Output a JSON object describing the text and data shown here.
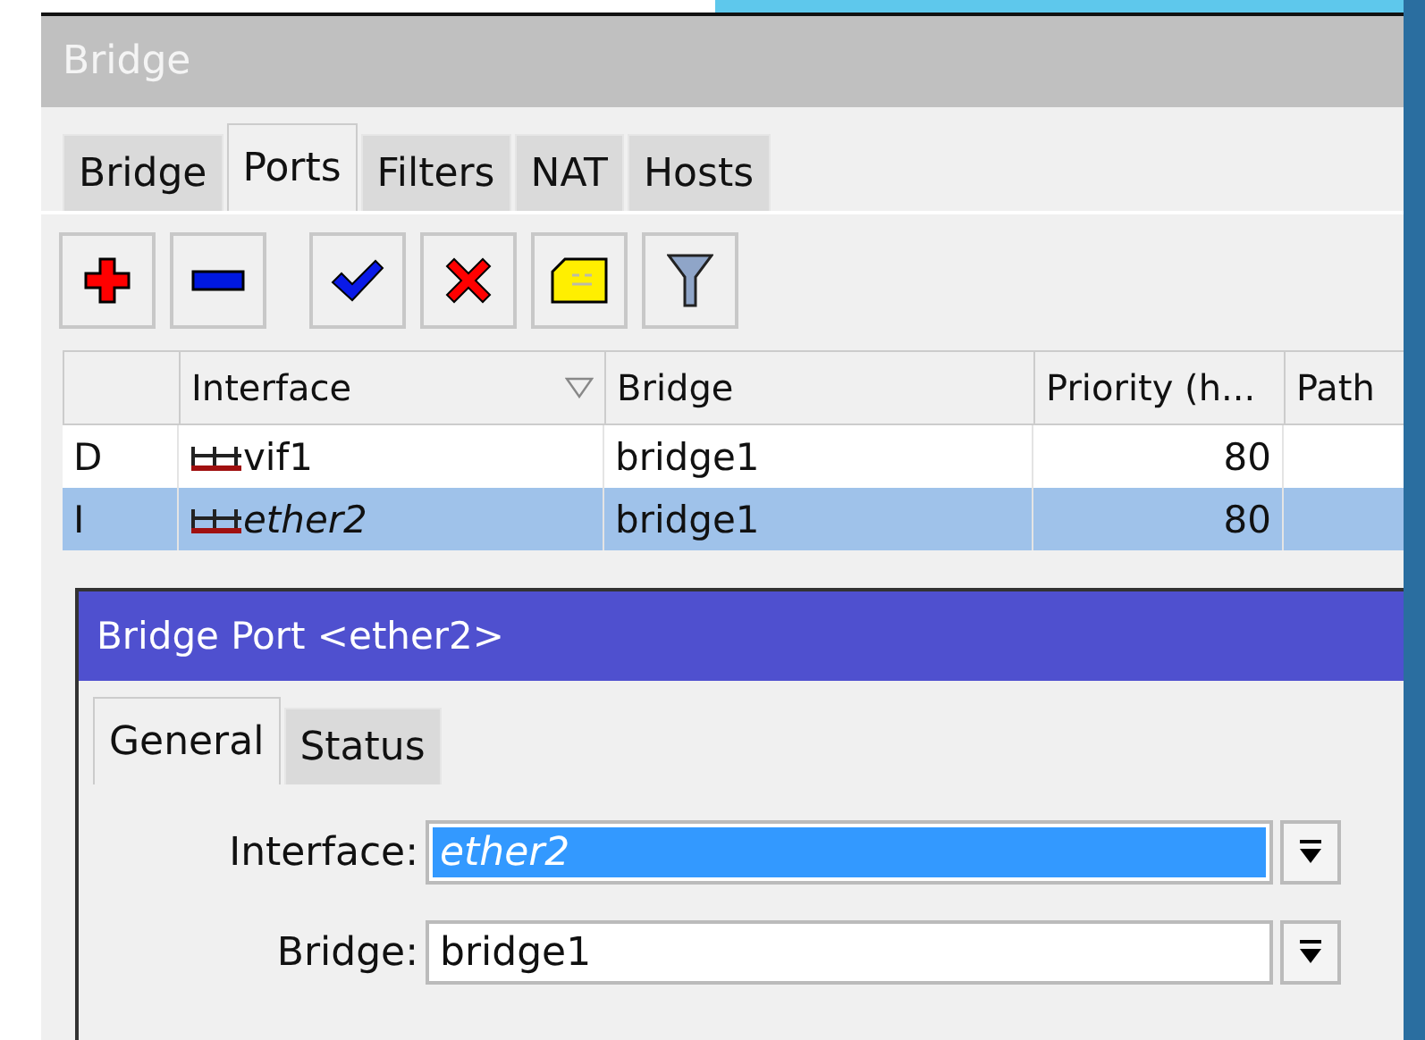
{
  "window": {
    "title": "Bridge"
  },
  "tabs": [
    {
      "label": "Bridge",
      "selected": false
    },
    {
      "label": "Ports",
      "selected": true
    },
    {
      "label": "Filters",
      "selected": false
    },
    {
      "label": "NAT",
      "selected": false
    },
    {
      "label": "Hosts",
      "selected": false
    }
  ],
  "toolbar": [
    {
      "kind": "add"
    },
    {
      "kind": "remove"
    },
    {
      "kind": "enable"
    },
    {
      "kind": "disable"
    },
    {
      "kind": "comment"
    },
    {
      "kind": "filter"
    }
  ],
  "table": {
    "columns": [
      {},
      {
        "label": "Interface",
        "sort": true
      },
      {
        "label": "Bridge"
      },
      {
        "label": "Priority (h..."
      },
      {
        "label": "Path"
      }
    ],
    "rows": [
      {
        "flag": "D",
        "interface": "vif1",
        "bridge": "bridge1",
        "priority": "80",
        "inactive": false,
        "selected": false
      },
      {
        "flag": "I",
        "interface": "ether2",
        "bridge": "bridge1",
        "priority": "80",
        "inactive": true,
        "selected": true
      }
    ]
  },
  "dialog": {
    "title": "Bridge Port <ether2>",
    "tabs": [
      {
        "label": "General",
        "selected": true
      },
      {
        "label": "Status",
        "selected": false
      }
    ],
    "fields": [
      {
        "label": "Interface:",
        "value": "ether2",
        "highlighted": true,
        "italic": true
      },
      {
        "label": "Bridge:",
        "value": "bridge1",
        "highlighted": false,
        "italic": false
      }
    ]
  }
}
